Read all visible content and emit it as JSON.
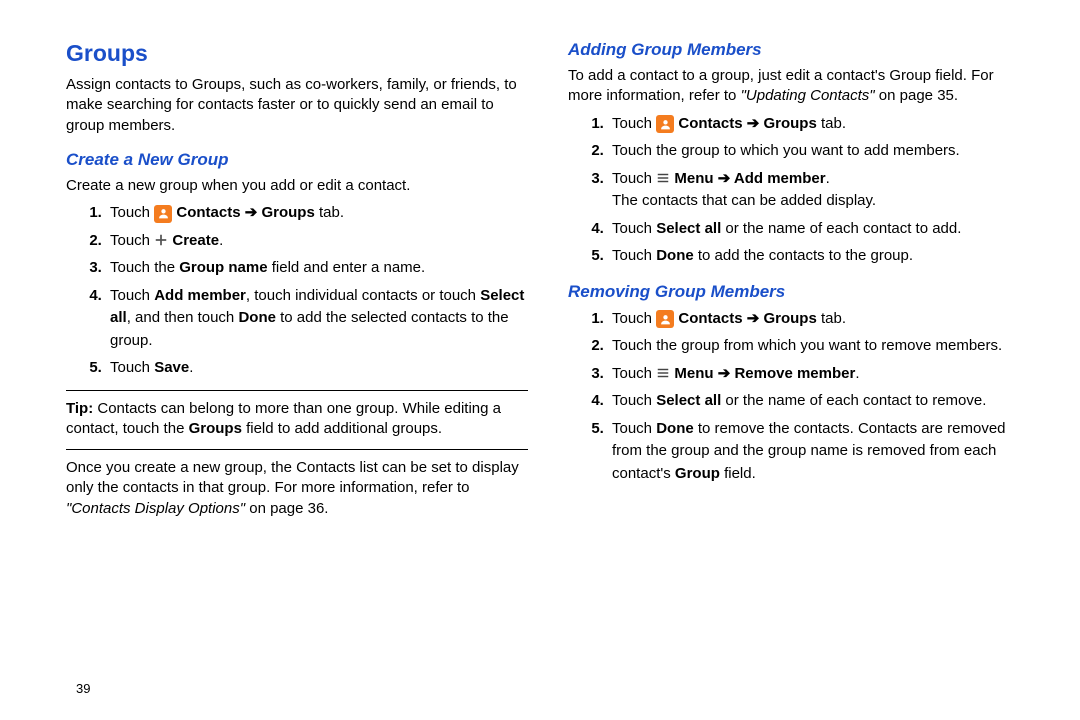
{
  "left": {
    "title": "Groups",
    "intro": "Assign contacts to Groups, such as co-workers, family, or friends, to make searching for contacts faster or to quickly send an email to group members.",
    "create": {
      "heading": "Create a New Group",
      "lead": "Create a new group when you add or edit a contact.",
      "step1_pre": "Touch ",
      "step1_b": "Contacts ➔ Groups",
      "step1_post": " tab.",
      "step2_pre": "Touch ",
      "step2_b": "Create",
      "step2_post": ".",
      "step3_pre": "Touch the ",
      "step3_b": "Group name",
      "step3_post": " field and enter a name.",
      "step4_a": "Touch ",
      "step4_b1": "Add member",
      "step4_c": ", touch individual contacts or touch ",
      "step4_b2": "Select all",
      "step4_d": ", and then touch ",
      "step4_b3": "Done",
      "step4_e": " to add the selected contacts to the group.",
      "step5_pre": "Touch ",
      "step5_b": "Save",
      "step5_post": "."
    },
    "tip_label": "Tip:",
    "tip_a": " Contacts can belong to more than one group. While editing a contact, touch the ",
    "tip_b": "Groups",
    "tip_c": " field to add additional groups.",
    "after_a": "Once you create a new group, the Contacts list can be set to display only the contacts in that group. For more information, refer to ",
    "after_ref": "\"Contacts Display Options\"",
    "after_b": " on page 36."
  },
  "right": {
    "adding": {
      "heading": "Adding Group Members",
      "lead_a": "To add a contact to a group, just edit a contact's Group field. For more information, refer to ",
      "lead_ref": "\"Updating Contacts\"",
      "lead_b": " on page 35.",
      "s1_pre": "Touch ",
      "s1_b": "Contacts ➔ Groups",
      "s1_post": " tab.",
      "s2": "Touch the group to which you want to add members.",
      "s3_pre": "Touch ",
      "s3_b": "Menu ➔ Add member",
      "s3_post": ".",
      "s3_line2": "The contacts that can be added display.",
      "s4_pre": "Touch ",
      "s4_b": "Select all",
      "s4_post": " or the name of each contact to add.",
      "s5_pre": "Touch ",
      "s5_b": "Done",
      "s5_post": " to add the contacts to the group."
    },
    "removing": {
      "heading": "Removing Group Members",
      "s1_pre": "Touch ",
      "s1_b": "Contacts ➔ Groups",
      "s1_post": " tab.",
      "s2": "Touch the group from which you want to remove members.",
      "s3_pre": "Touch ",
      "s3_b": "Menu ➔ Remove member",
      "s3_post": ".",
      "s4_pre": "Touch ",
      "s4_b": "Select all",
      "s4_post": " or the name of each contact to remove.",
      "s5_pre": "Touch ",
      "s5_b": "Done",
      "s5_mid": " to remove the contacts. Contacts are removed from the group and the group name is removed from each contact's ",
      "s5_b2": "Group",
      "s5_post": " field."
    }
  },
  "pagenum": "39"
}
